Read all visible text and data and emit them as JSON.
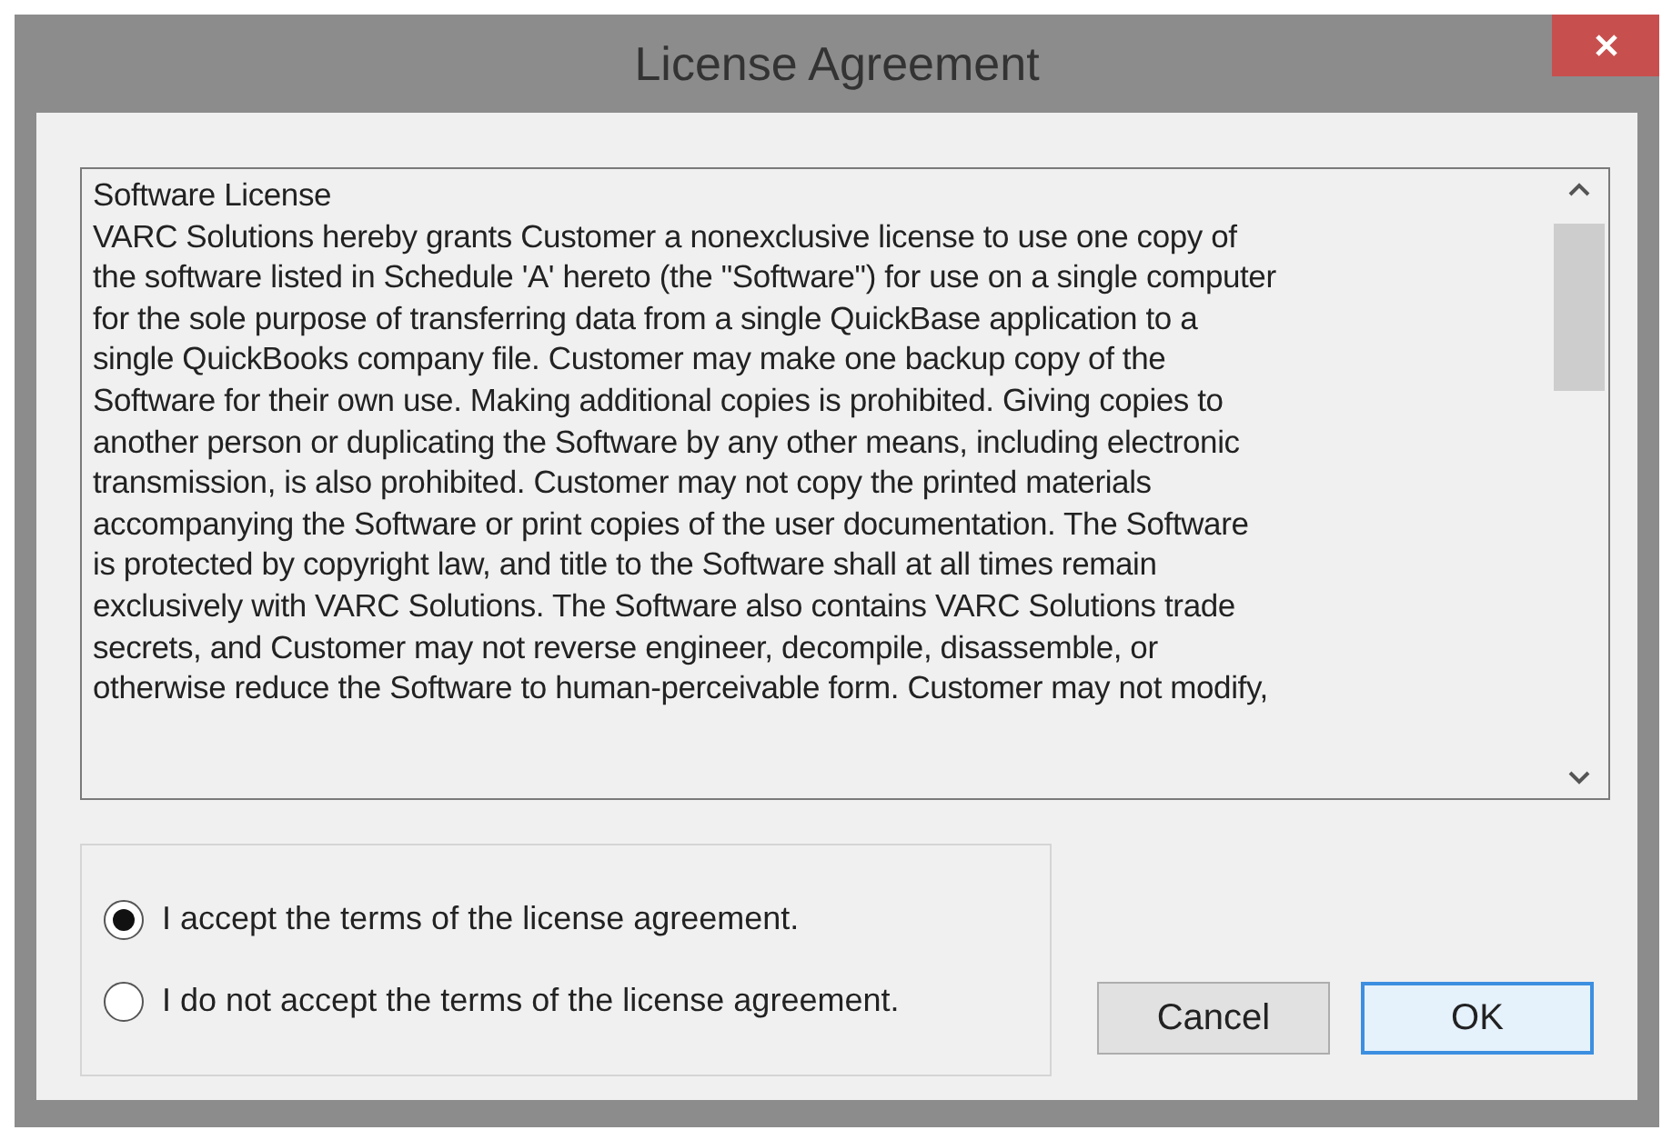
{
  "window": {
    "title": "License Agreement"
  },
  "license_text": {
    "lines": [
      "Software License",
      "VARC Solutions hereby grants Customer a nonexclusive license to use one copy of",
      "the software listed in Schedule 'A' hereto (the \"Software\") for use on a single computer",
      "for the sole purpose of transferring data from a single QuickBase application to a",
      "single QuickBooks company file. Customer may make one backup copy of the",
      "Software for their own use. Making additional copies is prohibited. Giving copies to",
      "another person or duplicating the Software by any other means, including electronic",
      "transmission, is also prohibited. Customer may not copy the printed materials",
      "accompanying the Software or print copies of the user documentation. The Software",
      "is protected by copyright law, and title to the Software shall at all times remain",
      "exclusively with VARC Solutions. The Software also contains VARC Solutions trade",
      "secrets, and Customer may not reverse engineer, decompile, disassemble, or",
      "otherwise reduce the Software to human-perceivable form. Customer may not modify,"
    ]
  },
  "options": [
    {
      "label": "I accept the terms of the license agreement.",
      "selected": true
    },
    {
      "label": "I do not accept the terms of the license agreement.",
      "selected": false
    }
  ],
  "buttons": [
    {
      "label": "Cancel",
      "default": false
    },
    {
      "label": "OK",
      "default": true
    }
  ]
}
